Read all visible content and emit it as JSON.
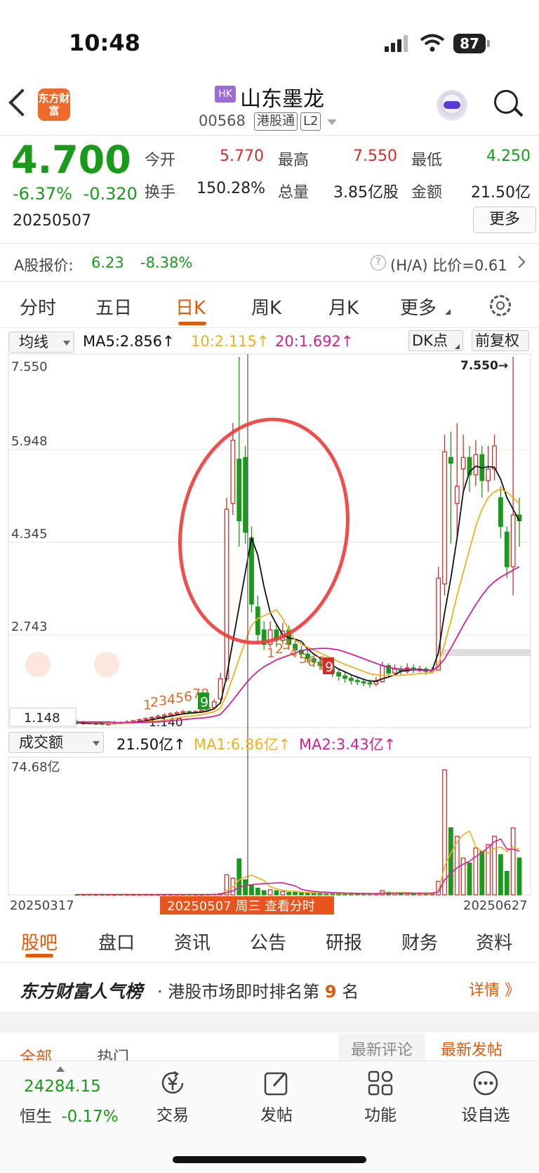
{
  "status_bar": {
    "time": "10:48",
    "battery": "87"
  },
  "header": {
    "logo_text": "东方财富",
    "hk_badge": "HK",
    "stock_name": "山东墨龙",
    "stock_code": "00568",
    "tags": [
      "港股通",
      "L2"
    ]
  },
  "quote": {
    "price": "4.700",
    "change_pct": "-6.37%",
    "change": "-0.320",
    "date": "20250507",
    "rows": [
      [
        {
          "label": "今开",
          "value": "5.770",
          "color": "#d0302c"
        },
        {
          "label": "最高",
          "value": "7.550",
          "color": "#d0302c"
        },
        {
          "label": "最低",
          "value": "4.250",
          "color": "#1a9a1a"
        }
      ],
      [
        {
          "label": "换手",
          "value": "150.28%",
          "color": "#222222"
        },
        {
          "label": "总量",
          "value": "3.85亿股",
          "color": "#222222"
        },
        {
          "label": "金额",
          "value": "21.50亿",
          "color": "#222222"
        }
      ]
    ],
    "more_label": "更多"
  },
  "a_share": {
    "label": "A股报价:",
    "price": "6.23",
    "change": "-8.38%",
    "help": "?",
    "ratio_label": "(H/A) 比价=0.61"
  },
  "period_tabs": [
    "分时",
    "五日",
    "日K",
    "周K",
    "月K",
    "更多"
  ],
  "active_period_index": 2,
  "indicators": {
    "select": "均线",
    "ma5": "MA5:2.856↑",
    "ma10": "10:2.115↑",
    "ma20": "20:1.692↑",
    "dk_label": "DK点",
    "adj_label": "前复权"
  },
  "volume_bar": {
    "select": "成交额",
    "amount": "21.50亿↑",
    "ma1": "MA1:6.86亿↑",
    "ma2": "MA2:3.43亿↑"
  },
  "colors": {
    "up": "#d0302c",
    "down": "#1a9a1a",
    "accent": "#e05a0a",
    "ma5": "#111111",
    "ma10": "#f0b020",
    "ma20": "#d020a0"
  },
  "chart_data": {
    "type": "candlestick",
    "price_axis_labels": [
      "7.550",
      "5.948",
      "4.345",
      "2.743"
    ],
    "low_label": "1.148",
    "low_marker": "1.140",
    "high_marker": "7.550→",
    "x_start": "20250317",
    "x_end": "20250627",
    "cursor_label": "20250507 周三 查看分时",
    "volume_axis_label": "74.68亿",
    "count_marks_1": [
      "1",
      "2",
      "3",
      "4",
      "5",
      "6",
      "7",
      "8",
      "9"
    ],
    "count_marks_2": [
      "1",
      "2",
      "3",
      "4",
      "5",
      "6",
      "7",
      "8",
      "9"
    ],
    "ylim": [
      1.1,
      7.6
    ],
    "candles": [
      {
        "o": 1.2,
        "c": 1.18,
        "h": 1.24,
        "l": 1.15
      },
      {
        "o": 1.18,
        "c": 1.19,
        "h": 1.22,
        "l": 1.15
      },
      {
        "o": 1.19,
        "c": 1.17,
        "h": 1.21,
        "l": 1.15
      },
      {
        "o": 1.17,
        "c": 1.18,
        "h": 1.21,
        "l": 1.15
      },
      {
        "o": 1.18,
        "c": 1.16,
        "h": 1.2,
        "l": 1.14
      },
      {
        "o": 1.16,
        "c": 1.17,
        "h": 1.19,
        "l": 1.14
      },
      {
        "o": 1.17,
        "c": 1.19,
        "h": 1.22,
        "l": 1.16
      },
      {
        "o": 1.19,
        "c": 1.18,
        "h": 1.21,
        "l": 1.16
      },
      {
        "o": 1.18,
        "c": 1.2,
        "h": 1.23,
        "l": 1.17
      },
      {
        "o": 1.2,
        "c": 1.22,
        "h": 1.24,
        "l": 1.19
      },
      {
        "o": 1.22,
        "c": 1.24,
        "h": 1.26,
        "l": 1.2
      },
      {
        "o": 1.24,
        "c": 1.26,
        "h": 1.28,
        "l": 1.22
      },
      {
        "o": 1.26,
        "c": 1.28,
        "h": 1.3,
        "l": 1.24
      },
      {
        "o": 1.28,
        "c": 1.3,
        "h": 1.33,
        "l": 1.26
      },
      {
        "o": 1.3,
        "c": 1.32,
        "h": 1.35,
        "l": 1.28
      },
      {
        "o": 1.32,
        "c": 1.34,
        "h": 1.37,
        "l": 1.3
      },
      {
        "o": 1.34,
        "c": 1.36,
        "h": 1.39,
        "l": 1.32
      },
      {
        "o": 1.36,
        "c": 1.38,
        "h": 1.41,
        "l": 1.34
      },
      {
        "o": 1.38,
        "c": 1.37,
        "h": 1.4,
        "l": 1.35
      },
      {
        "o": 1.37,
        "c": 1.38,
        "h": 1.4,
        "l": 1.35
      },
      {
        "o": 1.38,
        "c": 1.4,
        "h": 1.43,
        "l": 1.36
      },
      {
        "o": 1.4,
        "c": 1.45,
        "h": 1.48,
        "l": 1.39
      },
      {
        "o": 1.45,
        "c": 1.55,
        "h": 1.6,
        "l": 1.44
      },
      {
        "o": 1.6,
        "c": 1.95,
        "h": 2.05,
        "l": 1.58
      },
      {
        "o": 1.95,
        "c": 4.9,
        "h": 5.1,
        "l": 1.9
      },
      {
        "o": 5.0,
        "c": 6.1,
        "h": 6.4,
        "l": 4.8
      },
      {
        "o": 5.77,
        "c": 4.7,
        "h": 7.55,
        "l": 4.25
      },
      {
        "o": 5.8,
        "c": 4.5,
        "h": 6.0,
        "l": 4.3
      },
      {
        "o": 4.4,
        "c": 3.25,
        "h": 4.6,
        "l": 3.1
      },
      {
        "o": 3.2,
        "c": 2.72,
        "h": 3.4,
        "l": 2.6
      },
      {
        "o": 2.8,
        "c": 2.55,
        "h": 2.95,
        "l": 2.45
      },
      {
        "o": 2.55,
        "c": 2.8,
        "h": 2.95,
        "l": 2.5
      },
      {
        "o": 2.8,
        "c": 2.62,
        "h": 2.9,
        "l": 2.5
      },
      {
        "o": 2.62,
        "c": 2.78,
        "h": 2.92,
        "l": 2.55
      },
      {
        "o": 2.8,
        "c": 2.55,
        "h": 2.88,
        "l": 2.45
      },
      {
        "o": 2.55,
        "c": 2.45,
        "h": 2.62,
        "l": 2.38
      },
      {
        "o": 2.45,
        "c": 2.38,
        "h": 2.52,
        "l": 2.3
      },
      {
        "o": 2.38,
        "c": 2.3,
        "h": 2.45,
        "l": 2.22
      },
      {
        "o": 2.3,
        "c": 2.24,
        "h": 2.36,
        "l": 2.15
      },
      {
        "o": 2.24,
        "c": 2.18,
        "h": 2.3,
        "l": 2.1
      },
      {
        "o": 2.18,
        "c": 2.12,
        "h": 2.24,
        "l": 2.05
      },
      {
        "o": 2.12,
        "c": 2.06,
        "h": 2.18,
        "l": 1.98
      },
      {
        "o": 2.06,
        "c": 2.0,
        "h": 2.12,
        "l": 1.92
      },
      {
        "o": 2.0,
        "c": 1.96,
        "h": 2.06,
        "l": 1.88
      },
      {
        "o": 1.96,
        "c": 1.92,
        "h": 2.02,
        "l": 1.85
      },
      {
        "o": 1.92,
        "c": 1.9,
        "h": 1.98,
        "l": 1.84
      },
      {
        "o": 1.9,
        "c": 1.88,
        "h": 1.96,
        "l": 1.82
      },
      {
        "o": 1.88,
        "c": 1.86,
        "h": 1.94,
        "l": 1.8
      },
      {
        "o": 1.86,
        "c": 1.9,
        "h": 1.98,
        "l": 1.82
      },
      {
        "o": 1.9,
        "c": 2.18,
        "h": 2.25,
        "l": 1.88
      },
      {
        "o": 2.18,
        "c": 2.05,
        "h": 2.22,
        "l": 1.98
      },
      {
        "o": 2.05,
        "c": 2.12,
        "h": 2.2,
        "l": 2.0
      },
      {
        "o": 2.12,
        "c": 2.08,
        "h": 2.18,
        "l": 2.02
      },
      {
        "o": 2.08,
        "c": 2.14,
        "h": 2.22,
        "l": 2.04
      },
      {
        "o": 2.14,
        "c": 2.1,
        "h": 2.2,
        "l": 2.05
      },
      {
        "o": 2.1,
        "c": 2.12,
        "h": 2.18,
        "l": 2.06
      },
      {
        "o": 2.12,
        "c": 2.08,
        "h": 2.16,
        "l": 2.02
      },
      {
        "o": 2.08,
        "c": 2.1,
        "h": 2.15,
        "l": 2.04
      },
      {
        "o": 2.1,
        "c": 3.7,
        "h": 3.9,
        "l": 2.1
      },
      {
        "o": 3.6,
        "c": 5.9,
        "h": 6.2,
        "l": 3.4
      },
      {
        "o": 5.8,
        "c": 5.7,
        "h": 6.25,
        "l": 4.3
      },
      {
        "o": 5.0,
        "c": 5.3,
        "h": 6.4,
        "l": 4.4
      },
      {
        "o": 5.6,
        "c": 5.8,
        "h": 6.2,
        "l": 5.2
      },
      {
        "o": 5.8,
        "c": 5.5,
        "h": 6.0,
        "l": 5.2
      },
      {
        "o": 5.5,
        "c": 5.85,
        "h": 6.1,
        "l": 5.3
      },
      {
        "o": 5.85,
        "c": 5.4,
        "h": 6.0,
        "l": 5.1
      },
      {
        "o": 5.4,
        "c": 5.6,
        "h": 6.0,
        "l": 5.2
      },
      {
        "o": 5.6,
        "c": 6.0,
        "h": 6.2,
        "l": 5.4
      },
      {
        "o": 5.1,
        "c": 4.6,
        "h": 5.3,
        "l": 4.4
      },
      {
        "o": 4.5,
        "c": 3.9,
        "h": 4.6,
        "l": 3.7
      },
      {
        "o": 3.9,
        "c": 4.8,
        "h": 7.55,
        "l": 3.4
      },
      {
        "o": 4.8,
        "c": 4.7,
        "h": 5.1,
        "l": 4.25
      }
    ],
    "ma5": [
      1.19,
      1.18,
      1.18,
      1.18,
      1.18,
      1.18,
      1.18,
      1.18,
      1.18,
      1.19,
      1.2,
      1.22,
      1.24,
      1.26,
      1.28,
      1.3,
      1.32,
      1.34,
      1.35,
      1.36,
      1.37,
      1.39,
      1.43,
      1.53,
      2.0,
      2.6,
      3.2,
      3.8,
      4.4,
      4.1,
      3.55,
      3.1,
      2.9,
      2.72,
      2.66,
      2.64,
      2.6,
      2.47,
      2.38,
      2.31,
      2.24,
      2.18,
      2.12,
      2.07,
      2.02,
      1.98,
      1.94,
      1.91,
      1.91,
      1.95,
      1.98,
      2.02,
      2.08,
      2.1,
      2.11,
      2.11,
      2.1,
      2.1,
      2.4,
      3.1,
      3.7,
      4.4,
      5.2,
      5.55,
      5.65,
      5.62,
      5.64,
      5.63,
      5.42,
      5.1,
      4.9,
      4.7
    ],
    "ma10": [
      1.2,
      1.2,
      1.19,
      1.19,
      1.19,
      1.18,
      1.18,
      1.18,
      1.18,
      1.18,
      1.19,
      1.2,
      1.21,
      1.22,
      1.23,
      1.25,
      1.27,
      1.29,
      1.3,
      1.31,
      1.33,
      1.35,
      1.38,
      1.44,
      1.68,
      1.98,
      2.3,
      2.6,
      2.88,
      3.0,
      3.05,
      3.1,
      3.15,
      3.0,
      2.8,
      2.62,
      2.55,
      2.5,
      2.45,
      2.4,
      2.35,
      2.3,
      2.25,
      2.2,
      2.16,
      2.12,
      2.08,
      2.04,
      2.02,
      2.01,
      2.01,
      2.01,
      2.01,
      2.02,
      2.03,
      2.04,
      2.05,
      2.06,
      2.2,
      2.55,
      2.95,
      3.4,
      3.8,
      4.2,
      4.6,
      4.9,
      5.1,
      5.2,
      5.25,
      5.2,
      5.1,
      5.0
    ],
    "ma20": [
      1.2,
      1.2,
      1.2,
      1.2,
      1.2,
      1.2,
      1.19,
      1.19,
      1.19,
      1.19,
      1.19,
      1.19,
      1.2,
      1.2,
      1.21,
      1.22,
      1.23,
      1.24,
      1.25,
      1.26,
      1.27,
      1.28,
      1.3,
      1.33,
      1.45,
      1.58,
      1.72,
      1.86,
      1.98,
      2.08,
      2.16,
      2.22,
      2.28,
      2.32,
      2.36,
      2.4,
      2.44,
      2.46,
      2.47,
      2.48,
      2.48,
      2.47,
      2.45,
      2.42,
      2.38,
      2.34,
      2.3,
      2.26,
      2.22,
      2.18,
      2.15,
      2.13,
      2.12,
      2.12,
      2.11,
      2.1,
      2.1,
      2.1,
      2.16,
      2.3,
      2.48,
      2.68,
      2.88,
      3.06,
      3.24,
      3.4,
      3.54,
      3.64,
      3.72,
      3.78,
      3.84,
      3.9
    ],
    "volumes": [
      0.2,
      0.2,
      0.2,
      0.2,
      0.2,
      0.2,
      0.2,
      0.2,
      0.2,
      0.2,
      0.2,
      0.2,
      0.2,
      0.2,
      0.2,
      0.2,
      0.2,
      0.2,
      0.2,
      0.2,
      0.2,
      0.3,
      0.4,
      0.8,
      12,
      10,
      21.5,
      9,
      6,
      4,
      2.5,
      3,
      2.5,
      2,
      1.5,
      1.5,
      1.2,
      1.2,
      1,
      1,
      1,
      0.9,
      0.8,
      0.8,
      0.7,
      0.7,
      0.6,
      0.6,
      0.6,
      2.5,
      1.5,
      1,
      1,
      0.8,
      0.8,
      0.7,
      0.7,
      0.6,
      8,
      74.68,
      40,
      35,
      22,
      19,
      28,
      26,
      30,
      35,
      24,
      14,
      40,
      22
    ]
  },
  "bottom_tabs": [
    "股吧",
    "盘口",
    "资讯",
    "公告",
    "研报",
    "财务",
    "资料"
  ],
  "rank": {
    "title": "东方财富人气榜",
    "text_prefix": "· 港股市场即时排名第",
    "rank": "9",
    "text_suffix": "名",
    "detail": "详情 》"
  },
  "feed_tabs": {
    "all": "全部",
    "hot": "热门",
    "latest_comment": "最新评论",
    "latest_post": "最新发帖"
  },
  "dock": {
    "index_value": "24284.15",
    "index_name": "恒生",
    "index_change": "-0.17%",
    "items": [
      {
        "label": "交易",
        "icon": "trade-icon"
      },
      {
        "label": "发帖",
        "icon": "compose-icon"
      },
      {
        "label": "功能",
        "icon": "grid-icon"
      },
      {
        "label": "设自选",
        "icon": "more-icon"
      }
    ]
  }
}
